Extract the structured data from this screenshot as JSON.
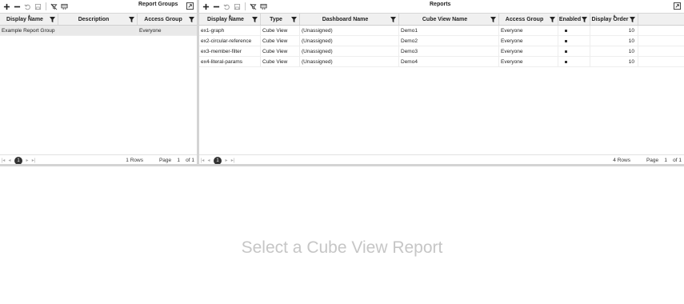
{
  "left_panel": {
    "title": "Report Groups",
    "columns": [
      "Display Name",
      "Description",
      "Access Group"
    ],
    "rows": [
      {
        "display_name": "Example Report Group",
        "description": "",
        "access_group": "Everyone"
      }
    ],
    "pager": {
      "current_page": "1",
      "rows_label": "1 Rows",
      "page_label": "Page",
      "page_value": "1",
      "of_label": "of 1"
    }
  },
  "right_panel": {
    "title": "Reports",
    "columns": [
      "Display Name",
      "Type",
      "Dashboard Name",
      "Cube View Name",
      "Access Group",
      "Enabled",
      "Display Order"
    ],
    "rows": [
      {
        "display_name": "ex1-graph",
        "type": "Cube View",
        "dashboard_name": "(Unassigned)",
        "cube_view_name": "Demo1",
        "access_group": "Everyone",
        "enabled": true,
        "display_order": "10"
      },
      {
        "display_name": "ex2-circular-reference",
        "type": "Cube View",
        "dashboard_name": "(Unassigned)",
        "cube_view_name": "Demo2",
        "access_group": "Everyone",
        "enabled": true,
        "display_order": "10"
      },
      {
        "display_name": "ex3-member-filter",
        "type": "Cube View",
        "dashboard_name": "(Unassigned)",
        "cube_view_name": "Demo3",
        "access_group": "Everyone",
        "enabled": true,
        "display_order": "10"
      },
      {
        "display_name": "ex4-literal-params",
        "type": "Cube View",
        "dashboard_name": "(Unassigned)",
        "cube_view_name": "Demo4",
        "access_group": "Everyone",
        "enabled": true,
        "display_order": "10"
      }
    ],
    "pager": {
      "current_page": "1",
      "rows_label": "4 Rows",
      "page_label": "Page",
      "page_value": "1",
      "of_label": "of 1"
    }
  },
  "placeholder_text": "Select a Cube View Report",
  "icons": [
    "add-icon",
    "remove-icon",
    "undo-icon",
    "save-icon",
    "no-filter-icon",
    "columns-icon",
    "maximize-icon",
    "filter-icon"
  ],
  "colors": {
    "header_bg": "#f0f0f0",
    "selected_row": "#e9e9e9",
    "splitter": "#d4d4d4",
    "placeholder": "#c6c6c6"
  }
}
